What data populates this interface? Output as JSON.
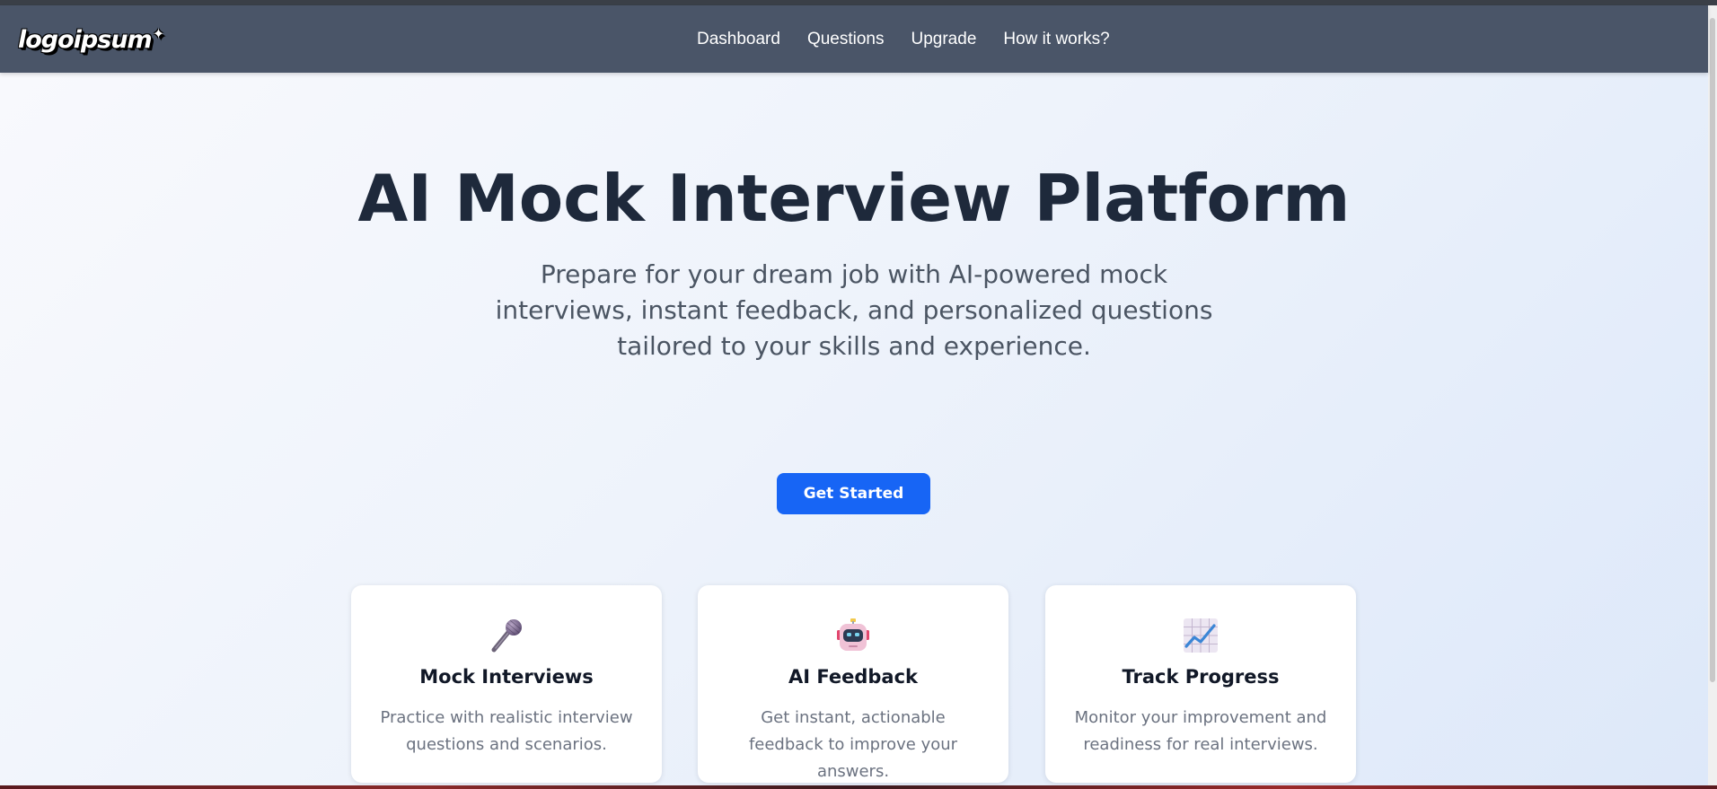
{
  "navbar": {
    "logo": "logoipsum",
    "links": [
      "Dashboard",
      "Questions",
      "Upgrade",
      "How it works?"
    ]
  },
  "hero": {
    "title": "AI Mock Interview Platform",
    "subtitle": "Prepare for your dream job with AI-powered mock interviews, instant feedback, and personalized questions tailored to your skills and experience.",
    "cta_label": "Get Started"
  },
  "features": [
    {
      "icon": "microphone-icon",
      "title": "Mock Interviews",
      "description": "Practice with realistic interview questions and scenarios."
    },
    {
      "icon": "robot-icon",
      "title": "AI Feedback",
      "description": "Get instant, actionable feedback to improve your answers."
    },
    {
      "icon": "chart-increasing-icon",
      "title": "Track Progress",
      "description": "Monitor your improvement and readiness for real interviews."
    }
  ],
  "colors": {
    "navbar": "#4a5568",
    "accent": "#1765f5",
    "title": "#1e293b",
    "card_background": "#ffffff"
  }
}
